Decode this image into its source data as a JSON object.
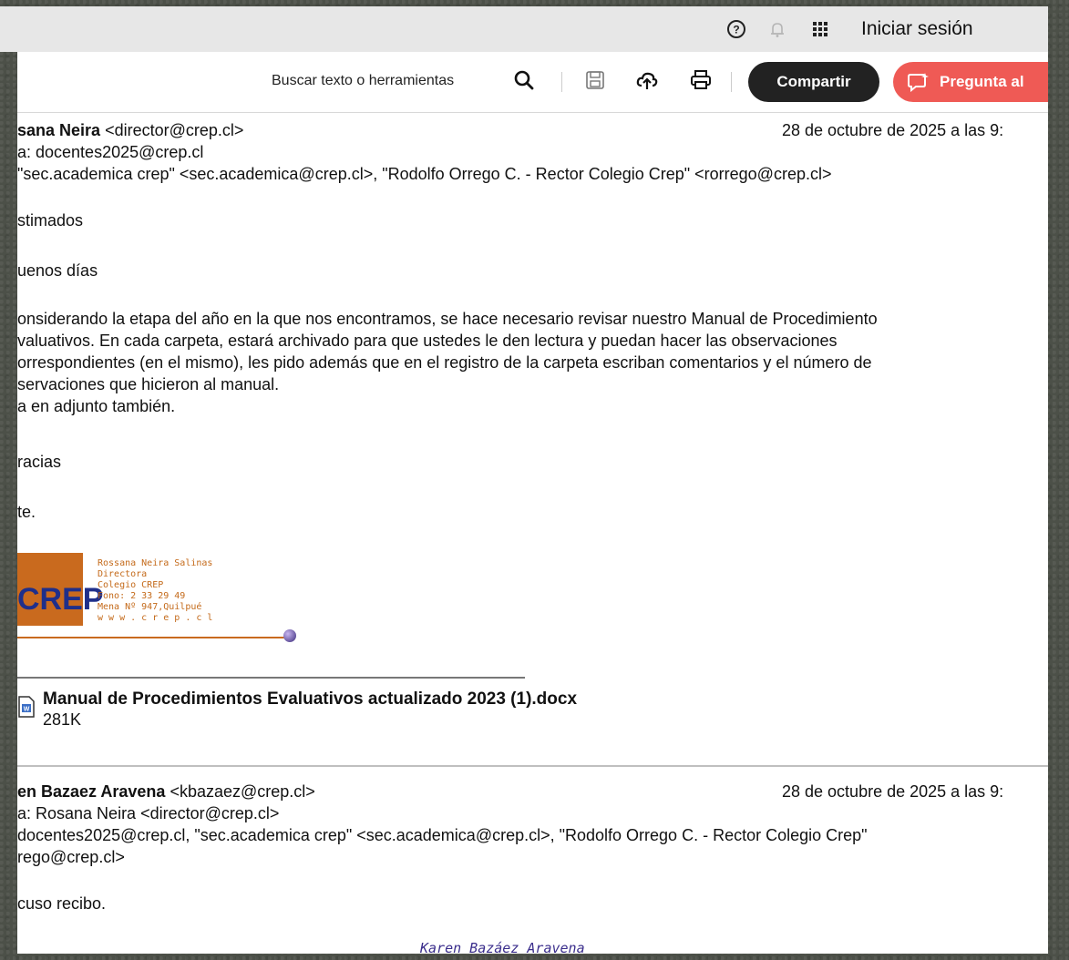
{
  "topbar": {
    "signin_label": "Iniciar sesión",
    "icons": [
      "help-icon",
      "bell-icon",
      "apps-grid-icon"
    ]
  },
  "toolbar": {
    "search_label": "Buscar texto o herramientas",
    "share_label": "Compartir",
    "ask_label": "Pregunta al",
    "icons": [
      "search-icon",
      "save-icon",
      "upload-icon",
      "print-icon",
      "ai-sparkle-icon"
    ],
    "share_color": "#222222",
    "ask_color": "#ef5a55"
  },
  "email1": {
    "sender_name": "sana Neira",
    "sender_email": "<director@crep.cl>",
    "date": "28 de octubre de 2025 a las 9:",
    "to": "a: docentes2025@crep.cl",
    "cc": "\"sec.academica crep\" <sec.academica@crep.cl>, \"Rodolfo Orrego C. - Rector Colegio Crep\" <rorrego@crep.cl>",
    "body": {
      "l1": "stimados",
      "l2": "uenos días",
      "l3": "onsiderando la etapa del año en la que nos encontramos, se hace necesario  revisar nuestro Manual de Procedimiento",
      "l4": "valuativos.  En cada carpeta, estará archivado para que ustedes le den lectura y puedan hacer las observaciones",
      "l5": "orrespondientes (en el mismo), les pido además que en el registro de la carpeta escriban comentarios y el número de",
      "l6": "servaciones que hicieron al manual.",
      "l7": "a en adjunto también.",
      "l8": "racias",
      "l9": "te."
    },
    "signature": {
      "logo_text": "CREP",
      "lines": "Rossana Neira Salinas\nDirectora\nColegio CREP\nFono: 2 33 29 49\nMena Nº 947,Quilpué\nw w w . c r e p . c l"
    },
    "attachment": {
      "name": "Manual de Procedimientos Evaluativos actualizado 2023 (1).docx",
      "size": "281K"
    }
  },
  "email2": {
    "sender_name": "en Bazaez Aravena",
    "sender_email": "<kbazaez@crep.cl>",
    "date": "28 de octubre de 2025 a las 9:",
    "to": "a: Rosana Neira <director@crep.cl>",
    "cc1": "docentes2025@crep.cl, \"sec.academica crep\" <sec.academica@crep.cl>, \"Rodolfo Orrego C. - Rector Colegio Crep\"",
    "cc2": "rego@crep.cl>",
    "body": "cuso recibo.",
    "signature": "Karen Bazáez Aravena"
  }
}
